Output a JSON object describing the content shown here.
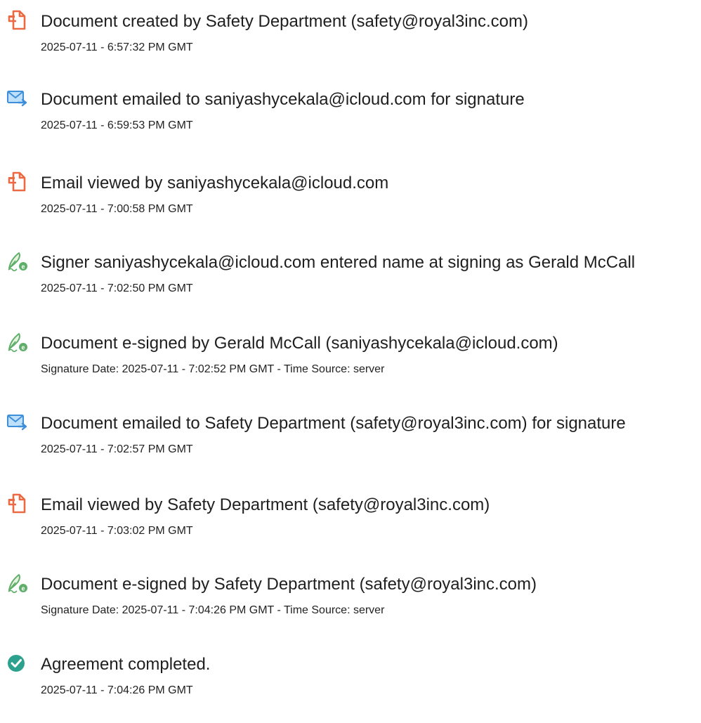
{
  "events": [
    {
      "icon": "document-created-icon",
      "title": "Document created by Safety Department (safety@royal3inc.com)",
      "detail": "2025-07-11 - 6:57:32 PM GMT"
    },
    {
      "icon": "email-sent-icon",
      "title": "Document emailed to saniyashycekala@icloud.com for signature",
      "detail": "2025-07-11 - 6:59:53 PM GMT"
    },
    {
      "icon": "document-viewed-icon",
      "title": "Email viewed by saniyashycekala@icloud.com",
      "detail": "2025-07-11 - 7:00:58 PM GMT"
    },
    {
      "icon": "e-signature-icon",
      "title": "Signer saniyashycekala@icloud.com entered name at signing as Gerald McCall",
      "detail": "2025-07-11 - 7:02:50 PM GMT"
    },
    {
      "icon": "e-signature-icon",
      "title": "Document e-signed by Gerald McCall (saniyashycekala@icloud.com)",
      "detail": "Signature Date: 2025-07-11 - 7:02:52 PM GMT - Time Source: server"
    },
    {
      "icon": "email-sent-icon",
      "title": "Document emailed to Safety Department (safety@royal3inc.com) for signature",
      "detail": "2025-07-11 - 7:02:57 PM GMT"
    },
    {
      "icon": "document-viewed-icon",
      "title": "Email viewed by Safety Department (safety@royal3inc.com)",
      "detail": "2025-07-11 - 7:03:02 PM GMT"
    },
    {
      "icon": "e-signature-icon",
      "title": "Document e-signed by Safety Department (safety@royal3inc.com)",
      "detail": "Signature Date: 2025-07-11 - 7:04:26 PM GMT - Time Source: server"
    },
    {
      "icon": "check-circle-icon",
      "title": "Agreement completed.",
      "detail": "2025-07-11 - 7:04:26 PM GMT"
    }
  ],
  "colors": {
    "acrobat_orange": "#EB6A44",
    "email_blue": "#3C8FD8",
    "sign_green": "#5FAE69",
    "check_teal": "#2CA28E"
  }
}
